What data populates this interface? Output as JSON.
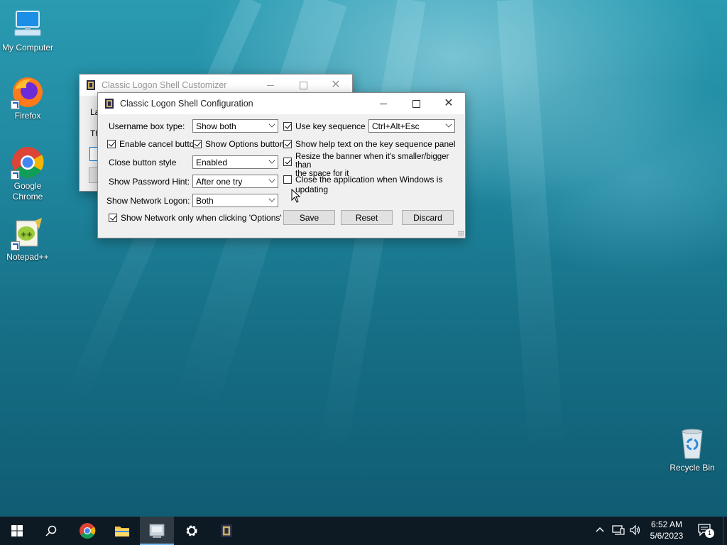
{
  "desktop": {
    "icons": [
      {
        "label": "My Computer",
        "icon": "computer-icon"
      },
      {
        "label": "Firefox",
        "icon": "firefox-icon"
      },
      {
        "label": "Google Chrome",
        "icon": "chrome-icon"
      },
      {
        "label": "Notepad++",
        "icon": "notepadpp-icon"
      },
      {
        "label": "Recycle Bin",
        "icon": "recycle-bin-icon"
      }
    ]
  },
  "back_window": {
    "title": "Classic Logon Shell Customizer",
    "partial_text_1": "La",
    "partial_text_2": "Th"
  },
  "config_window": {
    "title": "Classic Logon Shell Configuration",
    "username_box_type": {
      "label": "Username box type:",
      "value": "Show both"
    },
    "enable_cancel_button": {
      "label": "Enable cancel button",
      "checked": true
    },
    "show_options_button": {
      "label": "Show Options button",
      "checked": true
    },
    "close_button_style": {
      "label": "Close button style",
      "value": "Enabled"
    },
    "show_password_hint": {
      "label": "Show Password Hint:",
      "value": "After one try"
    },
    "show_network_logon": {
      "label": "Show Network Logon:",
      "value": "Both"
    },
    "show_network_only": {
      "label": "Show Network only when clicking 'Options'",
      "checked": true
    },
    "use_key_sequence": {
      "label": "Use key sequence",
      "checked": true,
      "value": "Ctrl+Alt+Esc"
    },
    "show_help_text": {
      "label": "Show help text on the key sequence panel",
      "checked": true
    },
    "resize_banner": {
      "label_line1": "Resize the banner when it's smaller/bigger than",
      "label_line2": "the space for it",
      "checked": true
    },
    "close_when_updating": {
      "label": "Close the application when Windows is updating",
      "checked": false
    },
    "buttons": {
      "save": "Save",
      "reset": "Reset",
      "discard": "Discard"
    }
  },
  "taskbar": {
    "clock_time": "6:52 AM",
    "clock_date": "5/6/2023",
    "notification_count": "1"
  }
}
